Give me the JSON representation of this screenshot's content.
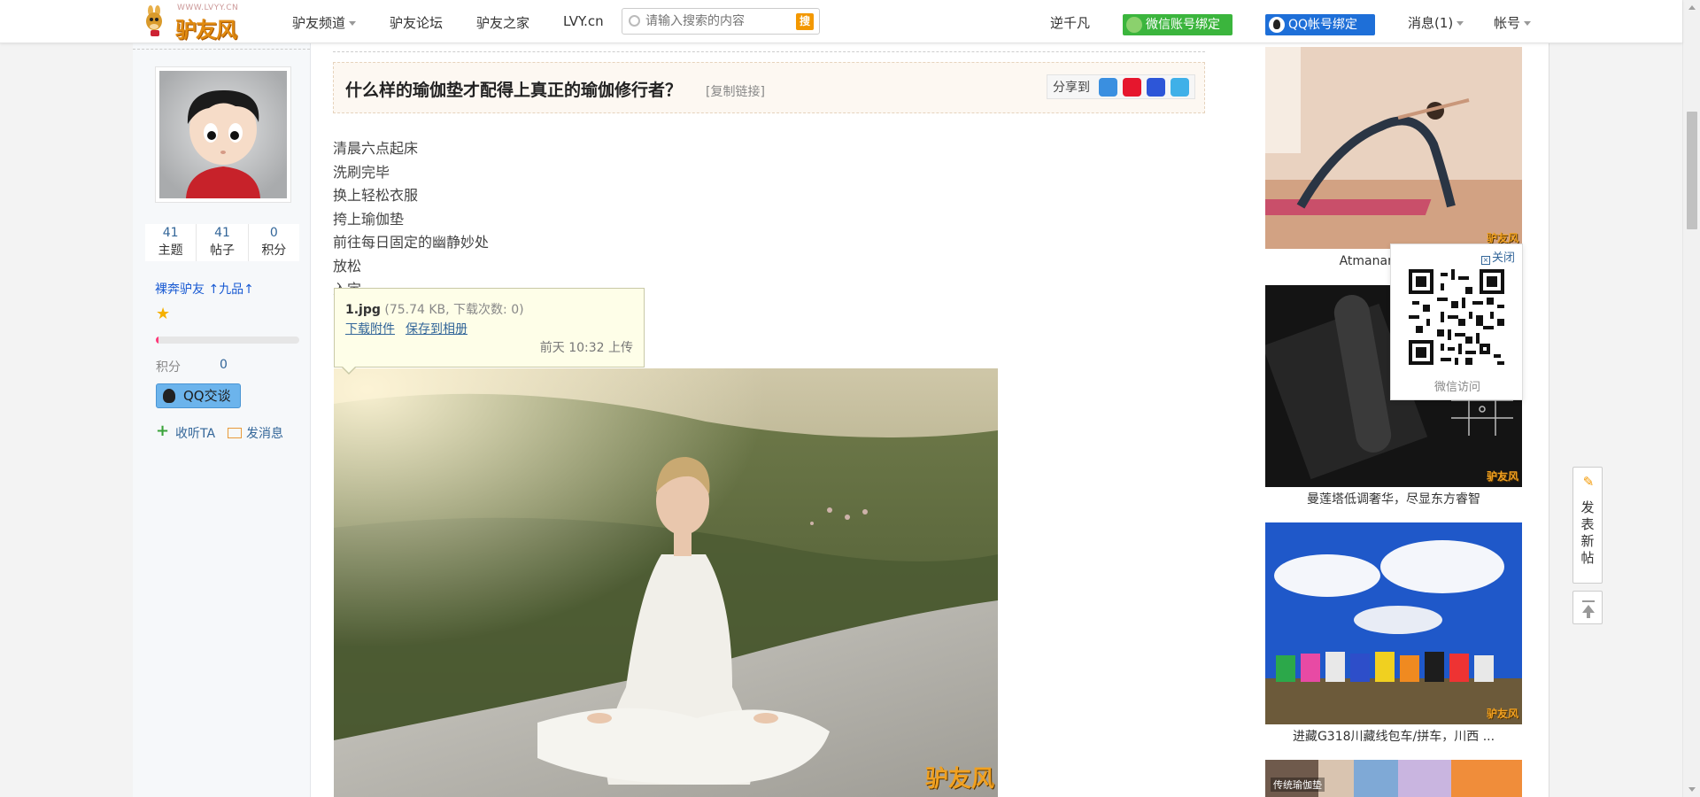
{
  "logo": {
    "site": "WWW.LVYY.CN",
    "brand": "驴友风"
  },
  "nav": {
    "items": [
      {
        "label": "驴友频道",
        "has_menu": true
      },
      {
        "label": "驴友论坛",
        "has_menu": false
      },
      {
        "label": "驴友之家",
        "has_menu": false
      },
      {
        "label": "LVY.cn",
        "has_menu": false
      }
    ],
    "search_placeholder": "请输入搜索的内容",
    "search_button": "搜",
    "user": "逆千凡",
    "wechat_bind": "微信账号绑定",
    "qq_bind": "QQ帐号绑定",
    "messages": "消息(1)",
    "account": "帐号"
  },
  "profile": {
    "stats": [
      {
        "value": "41",
        "label": "主题"
      },
      {
        "value": "41",
        "label": "帖子"
      },
      {
        "value": "0",
        "label": "积分"
      }
    ],
    "rank": "裸奔驴友 ↑九品↑",
    "exp_fraction": 0.02,
    "points_label": "积分",
    "points_value": "0",
    "qq_chat": "QQ交谈",
    "follow": "收听TA",
    "send_message": "发消息"
  },
  "post": {
    "title": "什么样的瑜伽垫才配得上真正的瑜伽修行者？",
    "copy_link": "[复制链接]",
    "share_label": "分享到",
    "share_icons": [
      "qzone-icon",
      "weibo-icon",
      "baidu-icon",
      "pengyou-icon"
    ],
    "lines": [
      "清晨六点起床",
      "洗刷完毕",
      "换上轻松衣服",
      "挎上瑜伽垫",
      "前往每日固定的幽静妙处",
      "放松",
      "入定"
    ]
  },
  "attachment": {
    "filename": "1.jpg",
    "meta": "(75.74 KB, 下载次数: 0)",
    "download": "下载附件",
    "save": "保存到相册",
    "uploaded": "前天 10:32 上传"
  },
  "image_watermark": "驴友风",
  "sidebar": {
    "cards": [
      {
        "caption": "Atmananda（曼莲"
      },
      {
        "caption": "曼莲塔低调奢华，尽显东方睿智"
      },
      {
        "caption": "进藏G318川藏线包车/拼车，川西 ..."
      },
      {
        "caption": "传统瑜伽垫"
      }
    ]
  },
  "qr_popup": {
    "close": "关闭",
    "label": "微信访问"
  },
  "float": {
    "post": [
      "发",
      "表",
      "新",
      "帖"
    ]
  },
  "colors": {
    "accent": "#336699",
    "brand_orange": "#f39800",
    "wechat_green": "#3bb53d",
    "qq_blue": "#1e6fd8"
  }
}
